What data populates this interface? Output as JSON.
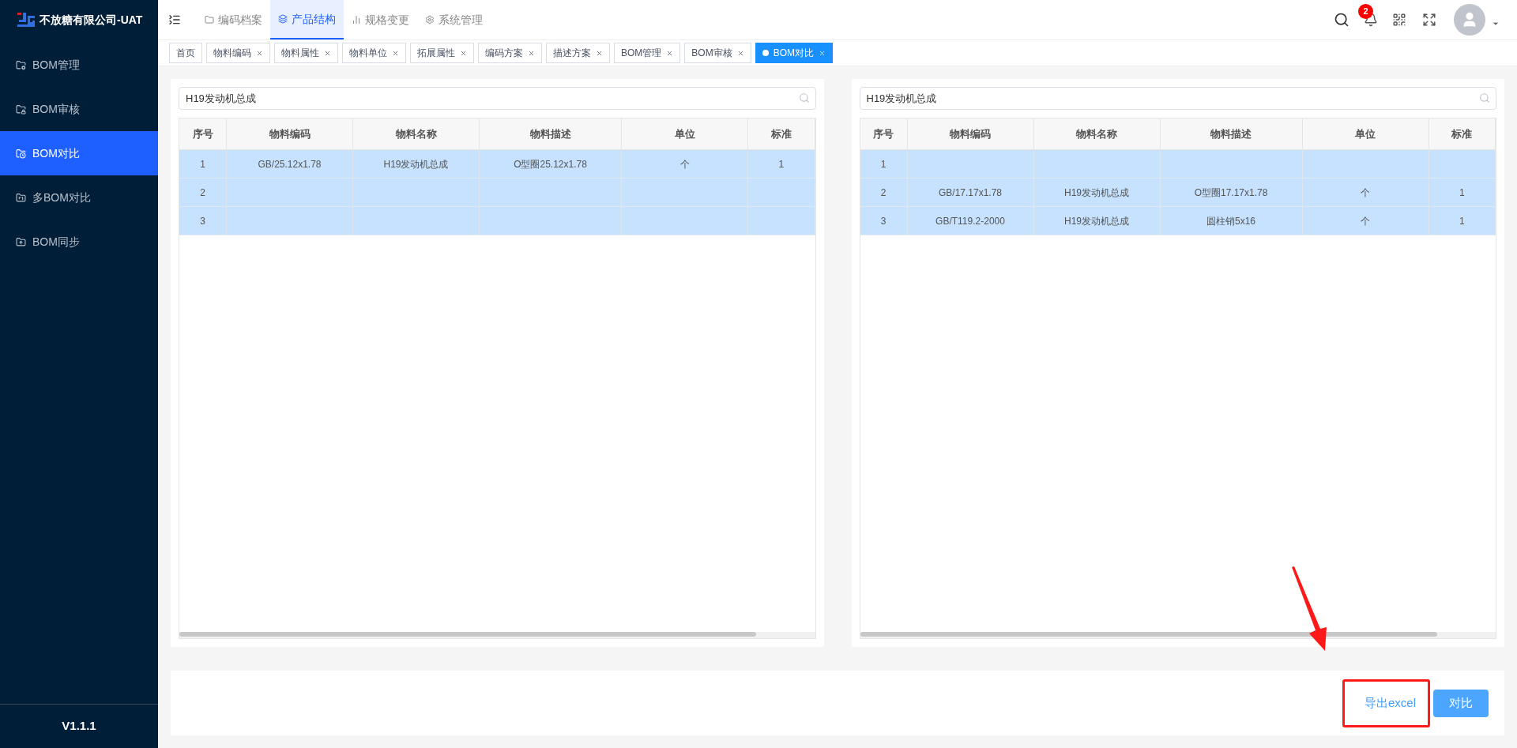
{
  "app": {
    "title": "不放糖有限公司-UAT",
    "version": "V1.1.1"
  },
  "sidebar": {
    "items": [
      {
        "label": "BOM管理",
        "selected": false
      },
      {
        "label": "BOM审核",
        "selected": false
      },
      {
        "label": "BOM对比",
        "selected": true
      },
      {
        "label": "多BOM对比",
        "selected": false
      },
      {
        "label": "BOM同步",
        "selected": false
      }
    ]
  },
  "top_nav": {
    "items": [
      {
        "label": "编码档案",
        "selected": false
      },
      {
        "label": "产品结构",
        "selected": true
      },
      {
        "label": "规格变更",
        "selected": false
      },
      {
        "label": "系统管理",
        "selected": false
      }
    ]
  },
  "header": {
    "notification_count": "2"
  },
  "page_tabs": [
    {
      "label": "首页",
      "closable": false,
      "selected": false
    },
    {
      "label": "物料编码",
      "closable": true,
      "selected": false
    },
    {
      "label": "物料属性",
      "closable": true,
      "selected": false
    },
    {
      "label": "物料单位",
      "closable": true,
      "selected": false
    },
    {
      "label": "拓展属性",
      "closable": true,
      "selected": false
    },
    {
      "label": "编码方案",
      "closable": true,
      "selected": false
    },
    {
      "label": "描述方案",
      "closable": true,
      "selected": false
    },
    {
      "label": "BOM管理",
      "closable": true,
      "selected": false
    },
    {
      "label": "BOM审核",
      "closable": true,
      "selected": false
    },
    {
      "label": "BOM对比",
      "closable": true,
      "selected": true
    }
  ],
  "panels": [
    {
      "search": {
        "value": "H19发动机总成"
      },
      "table": {
        "columns": [
          "序号",
          "物料编码",
          "物料名称",
          "物料描述",
          "单位",
          "标准"
        ],
        "rows": [
          {
            "selected": true,
            "cells": [
              "1",
              "GB/25.12x1.78",
              "H19发动机总成",
              "O型圈25.12x1.78",
              "个",
              "1"
            ]
          },
          {
            "selected": true,
            "cells": [
              "2",
              null,
              null,
              null,
              null,
              null
            ]
          },
          {
            "selected": true,
            "cells": [
              "3",
              null,
              null,
              null,
              null,
              null
            ]
          }
        ]
      }
    },
    {
      "search": {
        "value": "H19发动机总成"
      },
      "table": {
        "columns": [
          "序号",
          "物料编码",
          "物料名称",
          "物料描述",
          "单位",
          "标准"
        ],
        "rows": [
          {
            "selected": true,
            "cells": [
              "1",
              null,
              null,
              null,
              null,
              null
            ]
          },
          {
            "selected": true,
            "cells": [
              "2",
              "GB/17.17x1.78",
              "H19发动机总成",
              "O型圈17.17x1.78",
              "个",
              "1"
            ]
          },
          {
            "selected": true,
            "cells": [
              "3",
              "GB/T119.2-2000",
              "H19发动机总成",
              "圆柱销5x16",
              "个",
              "1"
            ]
          }
        ]
      }
    }
  ],
  "actions": [
    {
      "label": "导出excel",
      "kind": "text"
    },
    {
      "label": "对比",
      "kind": "primary"
    }
  ]
}
